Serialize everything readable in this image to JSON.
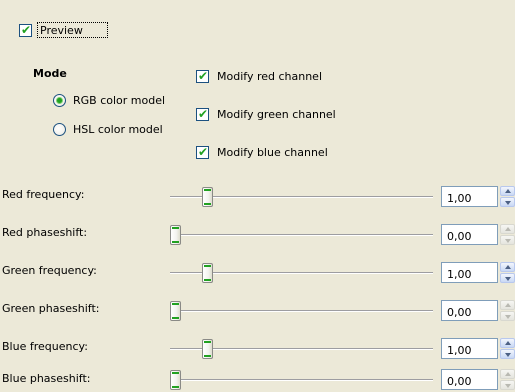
{
  "preview": {
    "label": "Preview",
    "checked": true
  },
  "mode": {
    "heading": "Mode",
    "options": [
      {
        "label": "RGB color model",
        "selected": true
      },
      {
        "label": "HSL color model",
        "selected": false
      }
    ]
  },
  "channels": [
    {
      "label": "Modify red channel",
      "checked": true
    },
    {
      "label": "Modify green channel",
      "checked": true
    },
    {
      "label": "Modify blue channel",
      "checked": true
    }
  ],
  "sliders": [
    {
      "label": "Red frequency:",
      "value": "1,00",
      "level": 0.125,
      "spin_up_enabled": true,
      "spin_down_enabled": true
    },
    {
      "label": "Red phaseshift:",
      "value": "0,00",
      "level": 0.0,
      "spin_up_enabled": false,
      "spin_down_enabled": true
    },
    {
      "label": "Green frequency:",
      "value": "1,00",
      "level": 0.125,
      "spin_up_enabled": true,
      "spin_down_enabled": true
    },
    {
      "label": "Green phaseshift:",
      "value": "0,00",
      "level": 0.0,
      "spin_up_enabled": false,
      "spin_down_enabled": true
    },
    {
      "label": "Blue frequency:",
      "value": "1,00",
      "level": 0.125,
      "spin_up_enabled": true,
      "spin_down_enabled": true
    },
    {
      "label": "Blue phaseshift:",
      "value": "0,00",
      "level": 0.0,
      "spin_up_enabled": false,
      "spin_down_enabled": true
    }
  ],
  "colors": {
    "background": "#ece9d8",
    "check_green": "#21a121",
    "border_blue": "#1c5180"
  }
}
